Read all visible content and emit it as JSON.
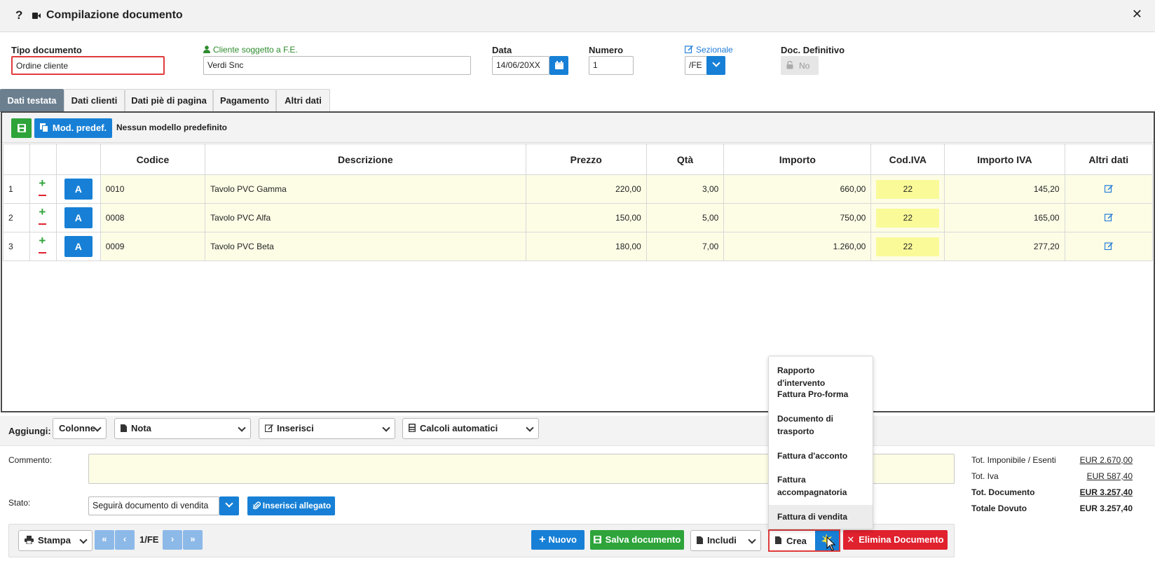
{
  "window": {
    "title": "Compilazione documento"
  },
  "header": {
    "tipo_documento": {
      "label": "Tipo documento",
      "value": "Ordine cliente"
    },
    "cliente": {
      "label": "Cliente soggetto a F.E.",
      "value": "Verdi Snc"
    },
    "data": {
      "label": "Data",
      "value": "14/06/20XX"
    },
    "numero": {
      "label": "Numero",
      "value": "1"
    },
    "sezionale": {
      "label": "Sezionale",
      "value": "/FE"
    },
    "doc_definitivo": {
      "label": "Doc. Definitivo",
      "value": "No"
    }
  },
  "tabs": [
    {
      "label": "Dati testata",
      "active": true
    },
    {
      "label": "Dati clienti",
      "active": false
    },
    {
      "label": "Dati piè di pagina",
      "active": false
    },
    {
      "label": "Pagamento",
      "active": false
    },
    {
      "label": "Altri dati",
      "active": false
    }
  ],
  "toolbar": {
    "mod_predef_label": "Mod. predef.",
    "modello_text": "Nessun modello predefinito"
  },
  "table": {
    "columns": [
      "Codice",
      "Descrizione",
      "Prezzo",
      "Qtà",
      "Importo",
      "Cod.IVA",
      "Importo IVA",
      "Altri dati"
    ],
    "rows": [
      {
        "n": "1",
        "a": "A",
        "codice": "0010",
        "descrizione": "Tavolo PVC Gamma",
        "prezzo": "220,00",
        "qta": "3,00",
        "importo": "660,00",
        "cod_iva": "22",
        "importo_iva": "145,20"
      },
      {
        "n": "2",
        "a": "A",
        "codice": "0008",
        "descrizione": "Tavolo PVC Alfa",
        "prezzo": "150,00",
        "qta": "5,00",
        "importo": "750,00",
        "cod_iva": "22",
        "importo_iva": "165,00"
      },
      {
        "n": "3",
        "a": "A",
        "codice": "0009",
        "descrizione": "Tavolo PVC Beta",
        "prezzo": "180,00",
        "qta": "7,00",
        "importo": "1.260,00",
        "cod_iva": "22",
        "importo_iva": "277,20"
      }
    ]
  },
  "aggiungi": {
    "label": "Aggiungi:",
    "colonne": "Colonne",
    "nota": "Nota",
    "inserisci": "Inserisci",
    "calcoli": "Calcoli automatici"
  },
  "commento": {
    "label": "Commento:",
    "value": ""
  },
  "stato": {
    "label": "Stato:",
    "value": "Seguirà documento di vendita",
    "allegato_label": "Inserisci allegato"
  },
  "totals": [
    {
      "label": "Tot. Imponibile / Esenti",
      "value": "EUR 2.670,00",
      "bold": false
    },
    {
      "label": "Tot. Iva",
      "value": "EUR 587,40",
      "bold": false
    },
    {
      "label": "Tot. Documento",
      "value": "EUR 3.257,40",
      "bold": true
    },
    {
      "label": "Totale Dovuto",
      "value": "EUR 3.257,40",
      "bold": true
    }
  ],
  "crea_menu": [
    {
      "label": "Rapporto d'intervento"
    },
    {
      "label": "Fattura Pro-forma"
    },
    {
      "label": "Documento di trasporto"
    },
    {
      "label": "Fattura d'acconto"
    },
    {
      "label": "Fattura accompagnatoria"
    },
    {
      "label": "Fattura di vendita",
      "highlighted": true
    }
  ],
  "bottom_bar": {
    "stampa": "Stampa",
    "page": "1/FE",
    "nuovo": "Nuovo",
    "salva": "Salva documento",
    "includi": "Includi",
    "crea": "Crea",
    "elimina": "Elimina Documento"
  },
  "colors": {
    "primary": "#1780d6",
    "success": "#2ea43a",
    "danger": "#e0212e",
    "row_bg": "#fdfde6",
    "iva_bg": "#fafa99",
    "tab_active": "#6b7f8f"
  }
}
